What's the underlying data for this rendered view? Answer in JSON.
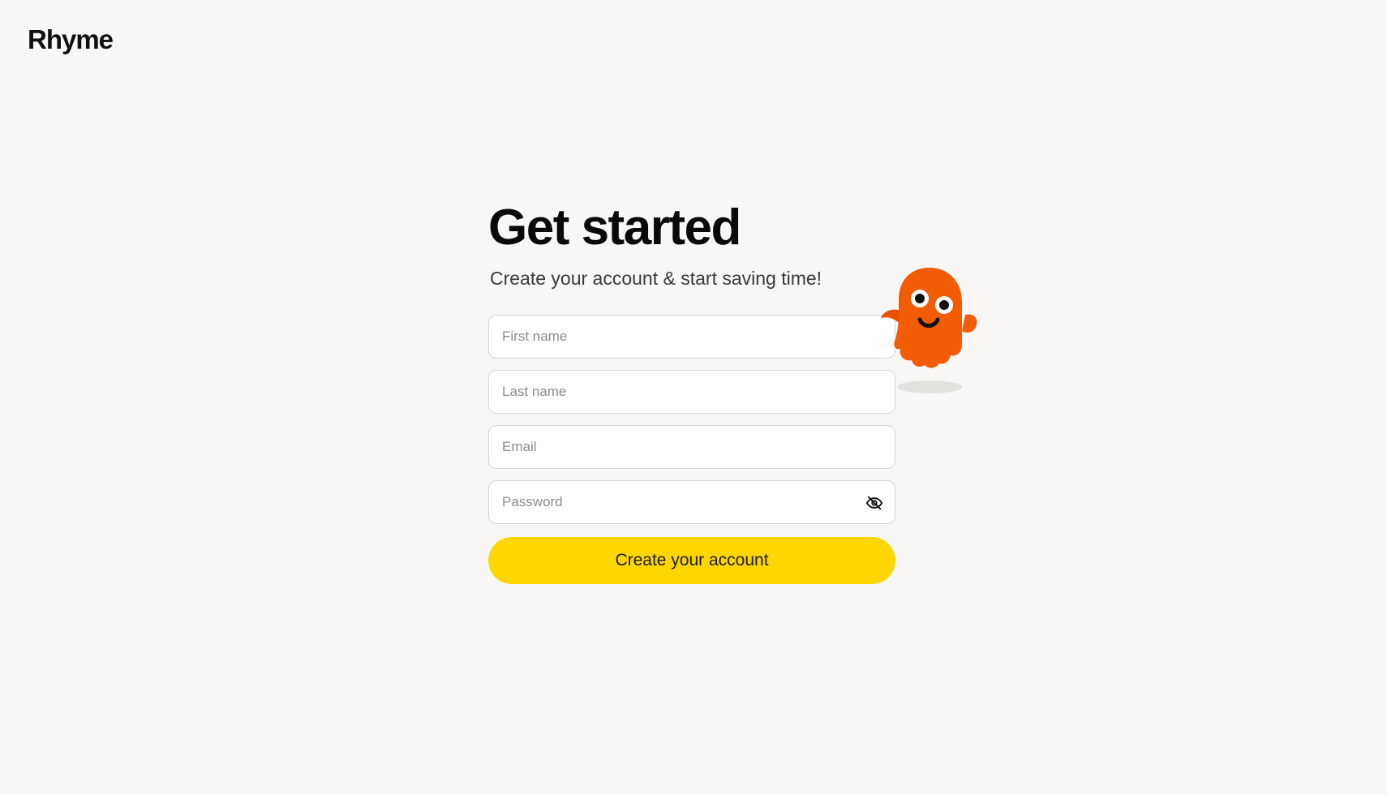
{
  "brand": {
    "logo_text": "Rhyme"
  },
  "signup": {
    "title": "Get started",
    "subtitle": "Create your account & start saving time!",
    "first_name_placeholder": "First name",
    "last_name_placeholder": "Last name",
    "email_placeholder": "Email",
    "password_placeholder": "Password",
    "password_toggle_icon": "eye-off-icon",
    "submit_label": "Create your account"
  },
  "mascot": {
    "icon": "orange-ghost-mascot",
    "color": "#f25c05"
  },
  "colors": {
    "background": "#f8f7f5",
    "button": "#ffd600",
    "input_border": "#d6d6d6"
  }
}
